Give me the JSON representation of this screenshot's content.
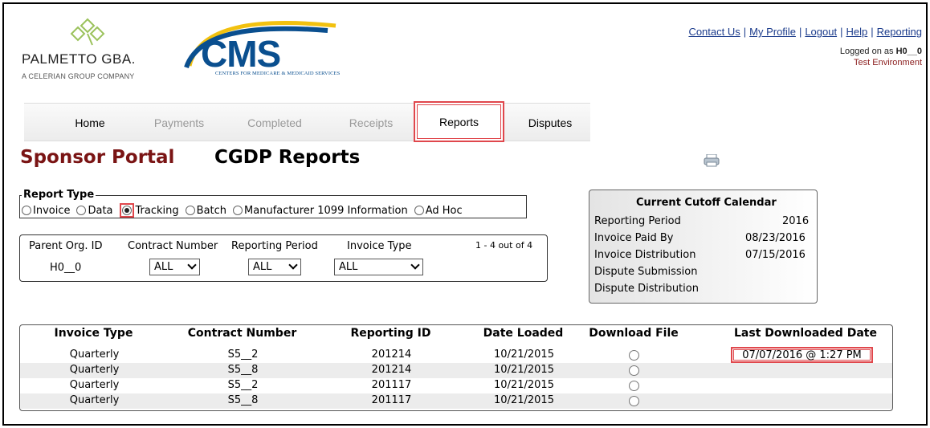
{
  "header": {
    "palmetto_name": "PALMETTO GBA.",
    "palmetto_tagline": "A CELERIAN GROUP COMPANY",
    "cms_logo_text": "CMS",
    "cms_subtitle": "CENTERS FOR MEDICARE & MEDICAID SERVICES",
    "links": [
      {
        "label": "Contact Us"
      },
      {
        "label": "My Profile"
      },
      {
        "label": "Logout"
      },
      {
        "label": "Help"
      },
      {
        "label": "Reporting"
      }
    ],
    "logged_on_prefix": "Logged on as ",
    "logged_on_user": "H0__0",
    "environment": "Test Environment"
  },
  "nav": {
    "tabs": [
      {
        "label": "Home"
      },
      {
        "label": "Payments"
      },
      {
        "label": "Completed"
      },
      {
        "label": "Receipts"
      },
      {
        "label": "Reports"
      },
      {
        "label": "Disputes"
      }
    ],
    "active_tab": "Reports"
  },
  "page": {
    "portal_title": "Sponsor Portal",
    "title": "CGDP Reports",
    "print_icon": "printer-icon"
  },
  "report_type": {
    "legend": "Report Type",
    "options": [
      {
        "label": "Invoice",
        "checked": false
      },
      {
        "label": "Data",
        "checked": false
      },
      {
        "label": "Tracking",
        "checked": true
      },
      {
        "label": "Batch",
        "checked": false
      },
      {
        "label": "Manufacturer 1099 Information",
        "checked": false
      },
      {
        "label": "Ad Hoc",
        "checked": false
      }
    ]
  },
  "filters": {
    "parent_org_label": "Parent Org. ID",
    "parent_org_value": "H0__0",
    "contract_label": "Contract Number",
    "contract_value": "ALL",
    "period_label": "Reporting Period",
    "period_value": "ALL",
    "invoice_type_label": "Invoice Type",
    "invoice_type_value": "ALL",
    "count": "1 - 4 out of 4"
  },
  "cutoff": {
    "title": "Current Cutoff Calendar",
    "rows": [
      {
        "label": "Reporting Period",
        "value": "2016"
      },
      {
        "label": "Invoice Paid By",
        "value": "08/23/2016"
      },
      {
        "label": "Invoice Distribution",
        "value": "07/15/2016"
      },
      {
        "label": "Dispute Submission",
        "value": ""
      },
      {
        "label": "Dispute Distribution",
        "value": ""
      }
    ]
  },
  "table": {
    "headers": [
      "Invoice Type",
      "Contract Number",
      "Reporting ID",
      "Date Loaded",
      "Download File",
      "Last Downloaded Date"
    ],
    "rows": [
      {
        "invoice_type": "Quarterly",
        "contract": "S5__2",
        "reporting_id": "201214",
        "date_loaded": "10/21/2015",
        "last_downloaded": "07/07/2016 @ 1:27 PM"
      },
      {
        "invoice_type": "Quarterly",
        "contract": "S5__8",
        "reporting_id": "201214",
        "date_loaded": "10/21/2015",
        "last_downloaded": ""
      },
      {
        "invoice_type": "Quarterly",
        "contract": "S5__2",
        "reporting_id": "201117",
        "date_loaded": "10/21/2015",
        "last_downloaded": ""
      },
      {
        "invoice_type": "Quarterly",
        "contract": "S5__8",
        "reporting_id": "201117",
        "date_loaded": "10/21/2015",
        "last_downloaded": ""
      }
    ]
  },
  "colors": {
    "portal_title": "#7a1414",
    "link": "#1c3c8c",
    "highlight": "#e0474c",
    "cms_blue": "#0a4f8f"
  }
}
